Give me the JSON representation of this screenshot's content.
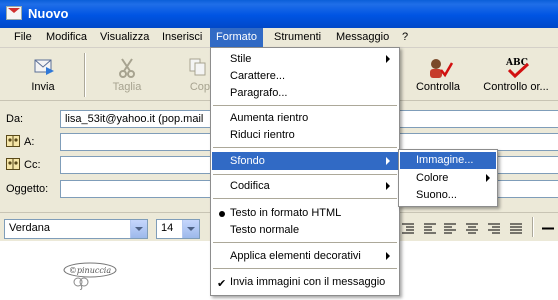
{
  "window": {
    "title": "Nuovo"
  },
  "menubar": {
    "items": [
      "File",
      "Modifica",
      "Visualizza",
      "Inserisci",
      "Formato",
      "Strumenti",
      "Messaggio",
      "?"
    ],
    "active": "Formato"
  },
  "toolbar": {
    "invia": "Invia",
    "taglia": "Taglia",
    "copia": "Cop",
    "controlla": "Controlla",
    "controllo_ortografico": "Controllo or..."
  },
  "fields": {
    "da_label": "Da:",
    "da_value": "lisa_53it@yahoo.it   (pop.mail",
    "a_label": "A:",
    "cc_label": "Cc:",
    "oggetto_label": "Oggetto:"
  },
  "format_toolbar": {
    "font": "Verdana",
    "size": "14"
  },
  "body": {
    "stamp_text": "©pinuccia"
  },
  "formato_menu": {
    "stile": "Stile",
    "carattere": "Carattere...",
    "paragrafo": "Paragrafo...",
    "aumenta_rientro": "Aumenta rientro",
    "riduci_rientro": "Riduci rientro",
    "sfondo": "Sfondo",
    "codifica": "Codifica",
    "testo_html": "Testo in formato HTML",
    "testo_normale": "Testo normale",
    "applica_elementi": "Applica elementi decorativi",
    "invia_immagini": "Invia immagini con il messaggio"
  },
  "sfondo_menu": {
    "immagine": "Immagine...",
    "colore": "Colore",
    "suono": "Suono..."
  },
  "colors": {
    "highlight": "#316ac5",
    "title_bar": "#0054e3"
  }
}
